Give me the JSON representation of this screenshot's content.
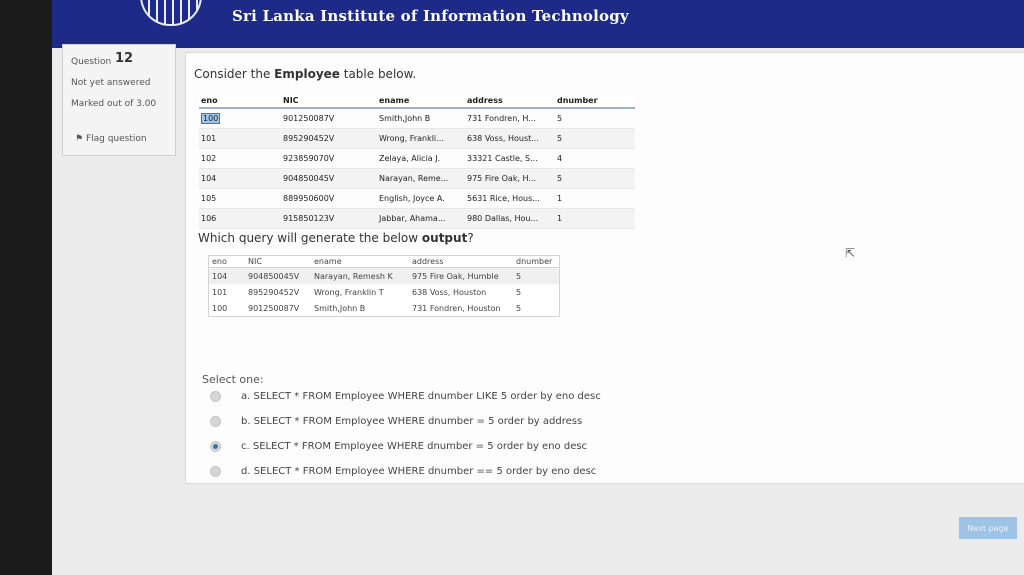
{
  "header": {
    "title": "Sri Lanka Institute of Information Technology"
  },
  "question_info": {
    "label": "Question",
    "number": "12",
    "state": "Not yet answered",
    "marked": "Marked out of 3.00",
    "flag": "Flag question"
  },
  "prompt": {
    "before": "Consider the ",
    "bold": "Employee",
    "after": " table below."
  },
  "employee_table": {
    "headers": [
      "eno",
      "NIC",
      "ename",
      "address",
      "dnumber"
    ],
    "rows": [
      [
        "100",
        "901250087V",
        "Smith,John B",
        "731 Fondren, H...",
        "5"
      ],
      [
        "101",
        "895290452V",
        "Wrong, Frankli...",
        "638 Voss, Houst...",
        "5"
      ],
      [
        "102",
        "923859070V",
        "Zelaya, Alicia J.",
        "33321 Castle, S...",
        "4"
      ],
      [
        "104",
        "904850045V",
        "Narayan, Reme...",
        "975 Fire Oak, H...",
        "5"
      ],
      [
        "105",
        "889950600V",
        "English, Joyce A.",
        "5631 Rice, Hous...",
        "1"
      ],
      [
        "106",
        "915850123V",
        "Jabbar, Ahama...",
        "980 Dallas, Hou...",
        "1"
      ]
    ]
  },
  "question2": {
    "before": "Which query will generate the below ",
    "bold": "output",
    "after": "?"
  },
  "output_table": {
    "headers": [
      "eno",
      "NIC",
      "ename",
      "address",
      "dnumber"
    ],
    "rows": [
      [
        "104",
        "904850045V",
        "Narayan, Remesh K",
        "975 Fire Oak, Humble",
        "5"
      ],
      [
        "101",
        "895290452V",
        "Wrong, Franklin T",
        "638 Voss, Houston",
        "5"
      ],
      [
        "100",
        "901250087V",
        "Smith,John B",
        "731 Fondren, Houston",
        "5"
      ]
    ]
  },
  "select_one": "Select one:",
  "options": [
    "a. SELECT * FROM Employee WHERE dnumber LIKE 5 order by eno desc",
    "b. SELECT * FROM Employee WHERE dnumber = 5 order by address",
    "c. SELECT * FROM Employee WHERE dnumber = 5 order by eno desc",
    "d. SELECT * FROM Employee WHERE dnumber == 5 order by eno desc"
  ],
  "selected_option": "c",
  "next_button": "Next page",
  "colors": {
    "header": "#1e2a87",
    "accent": "#3a6fb0"
  }
}
